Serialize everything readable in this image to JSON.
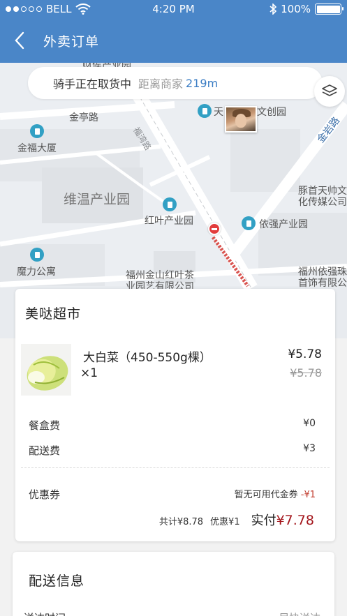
{
  "status_bar": {
    "carrier": "BELL",
    "time": "4:20 PM",
    "battery": "100%",
    "signal_bars_filled": 2,
    "signal_bars_total": 5
  },
  "nav": {
    "title": "外卖订单"
  },
  "map": {
    "rider_status": "骑手正在取货中",
    "distance_label": "距离商家",
    "distance": "219m",
    "labels": {
      "top_cut": "财侯产业园",
      "jinting": "金亭路",
      "jinfu": "金福大厦",
      "weiwen": "维温产业园",
      "hongye": "红叶产业园",
      "moli": "魔力公寓",
      "jinshan": "福州金山红叶茶",
      "jinshan2": "业园艺有限公司",
      "yiqiang": "依强产业园",
      "tianshuai": "豚首天帅文",
      "tianshuai2": "化传媒公司",
      "fzyq": "福州依强珠",
      "fzyq2": "首饰有限公",
      "jinyan": "金岩路",
      "wenchuang_a": "天",
      "wenchuang_b": "文创园",
      "road_diag": "福湾路"
    }
  },
  "order": {
    "shop_name": "美哒超市",
    "product": {
      "name": "大白菜（450-550g棵）",
      "qty": "×1",
      "price": "¥5.78",
      "original_price": "¥5.78"
    },
    "fees": [
      {
        "label": "餐盒费",
        "value": "¥0"
      },
      {
        "label": "配送费",
        "value": "¥3"
      }
    ],
    "coupon": {
      "label": "优惠券",
      "value": "暂无可用代金券",
      "amount": "-¥1"
    },
    "totals": {
      "subtotal": "共计¥8.78",
      "discount": "优惠¥1",
      "pay_label": "实付",
      "pay_amount": "¥7.78"
    }
  },
  "delivery": {
    "title": "配送信息",
    "row_label": "送达时间",
    "row_value": "尽快送达"
  },
  "colors": {
    "primary": "#4a86c8",
    "price_red": "#a3151b",
    "link_blue": "#3b7dc4"
  }
}
